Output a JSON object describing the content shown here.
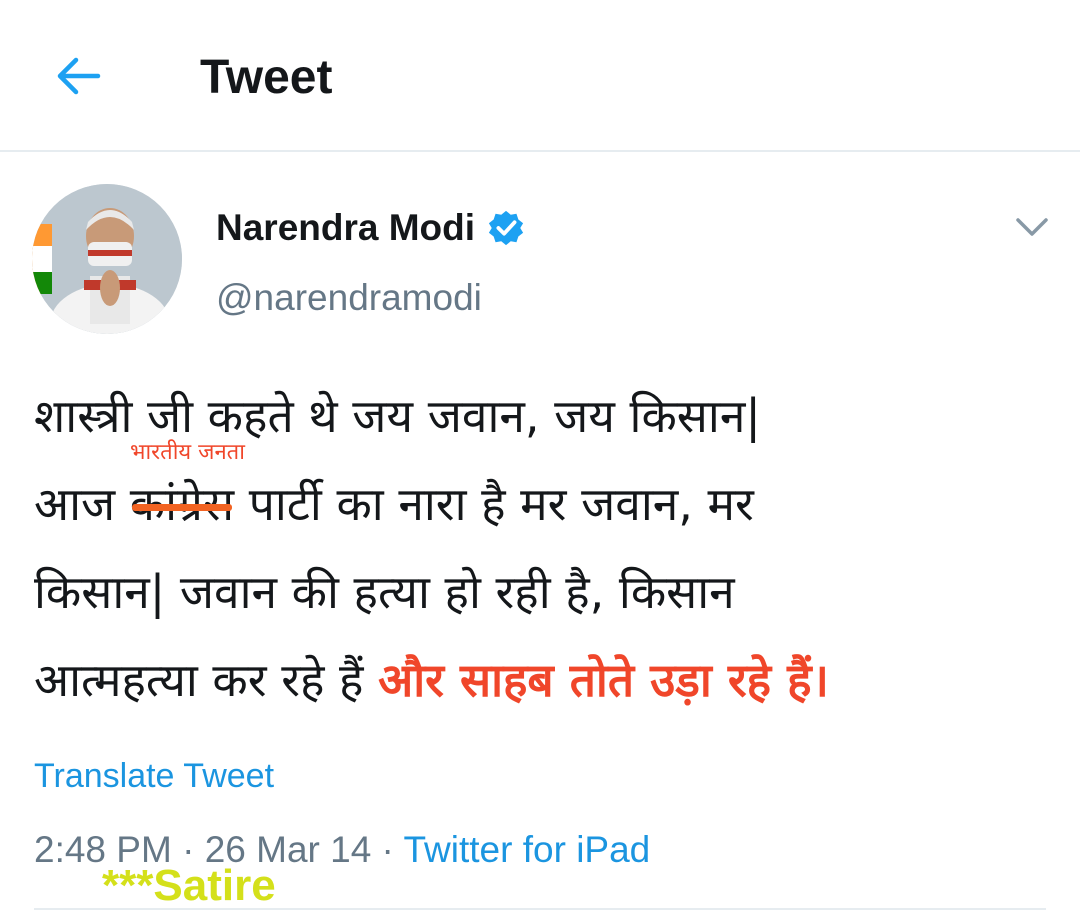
{
  "header": {
    "title": "Tweet"
  },
  "author": {
    "name": "Narendra Modi",
    "handle": "@narendramodi",
    "verified": true
  },
  "tweet": {
    "lines": [
      "शास्त्री जी कहते थे जय जवान, जय किसान|",
      {
        "before": "आज ",
        "struck": "कांग्रेस",
        "after": " पार्टी का नारा है मर जवान, मर"
      },
      "किसान| जवान की हत्या हो रही है, किसान",
      {
        "before": "आत्महत्या कर रहे हैं ",
        "highlight": "और साहब तोते उड़ा रहे हैं।"
      }
    ],
    "overwrite_label": "भारतीय जनता"
  },
  "translate_label": "Translate Tweet",
  "meta": {
    "time": "2:48 PM",
    "separator": " · ",
    "date": "26 Mar 14",
    "source": "Twitter for iPad"
  },
  "watermark": "***Satire",
  "colors": {
    "accent": "#1b95e0",
    "annotation": "#f0462a",
    "strike": "#f26322",
    "watermark": "#d4e01a",
    "muted": "#657786"
  },
  "icons": {
    "back": "arrow-left-icon",
    "verified": "verified-badge-icon",
    "caret": "chevron-down-icon"
  }
}
